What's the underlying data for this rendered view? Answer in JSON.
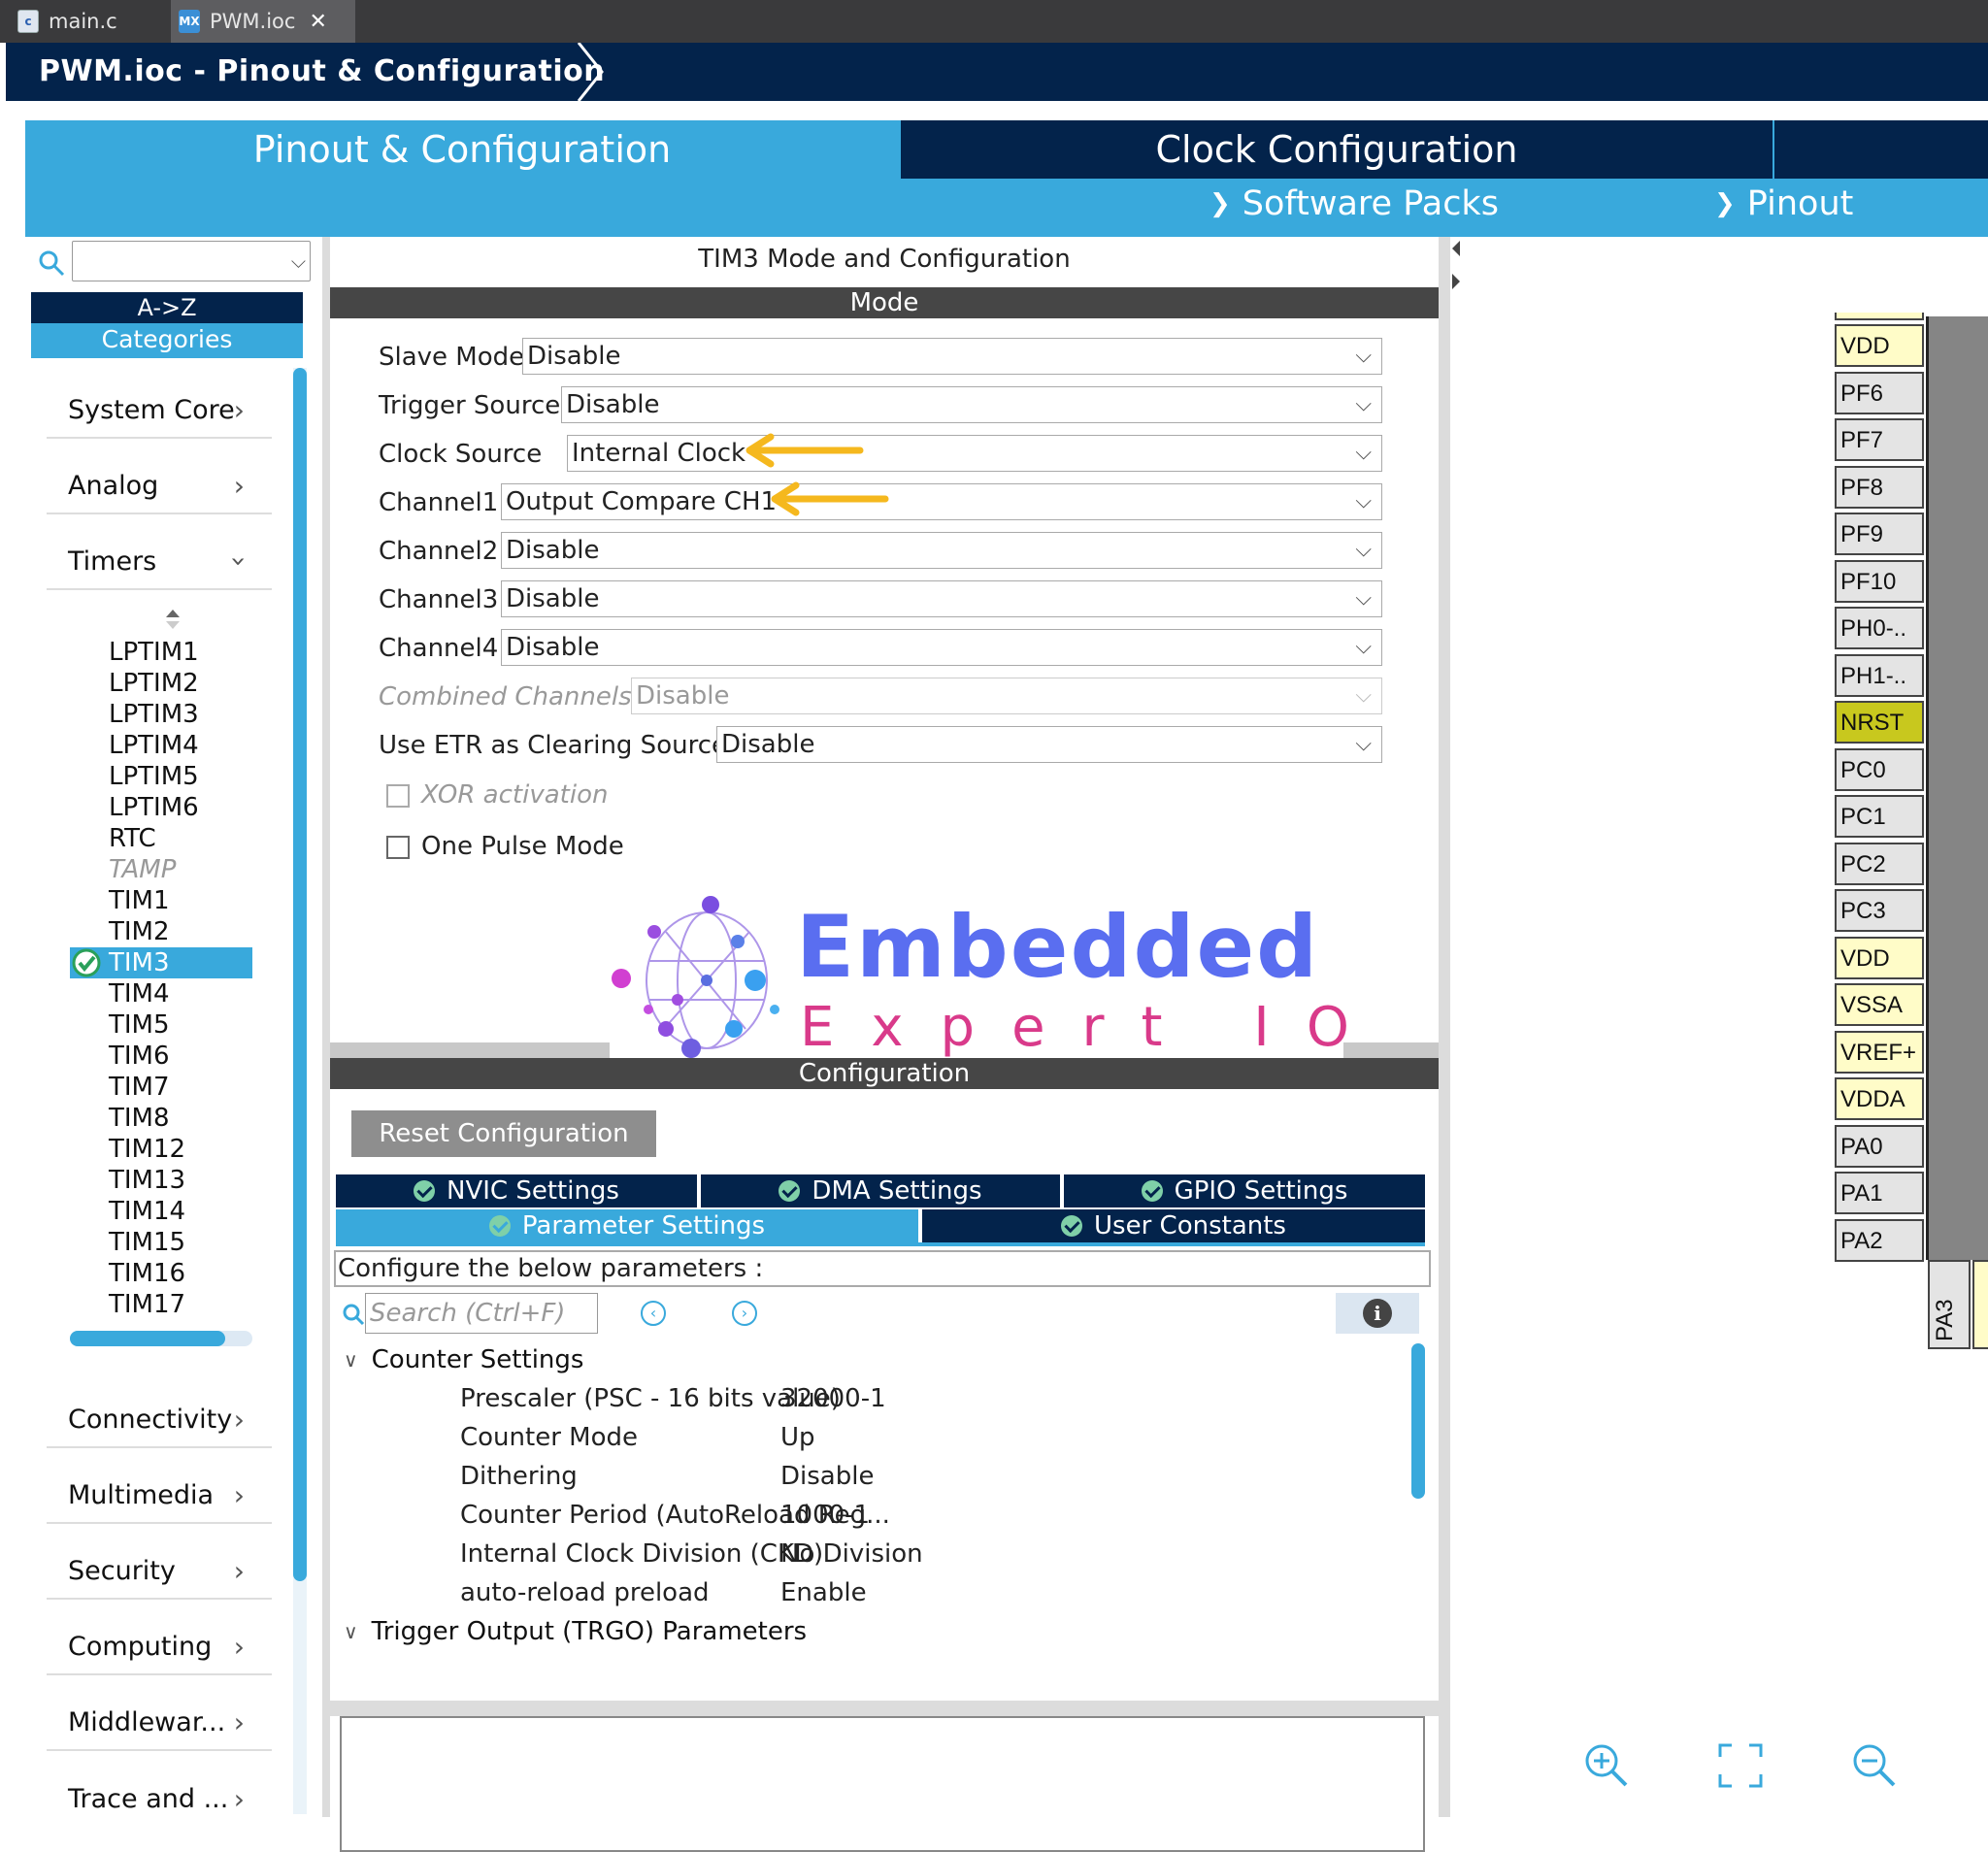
{
  "editor_tabs": [
    {
      "label": "main.c",
      "icon": "c-file-icon",
      "badge": "c"
    },
    {
      "label": "PWM.ioc",
      "icon": "mx-file-icon",
      "badge": "MX"
    }
  ],
  "window_title": "PWM.ioc - Pinout & Configuration",
  "main_tabs": {
    "pinout": "Pinout & Configuration",
    "clock": "Clock Configuration"
  },
  "sub_menus": {
    "software_packs": "Software Packs",
    "pinout": "Pinout"
  },
  "left": {
    "sort": "A->Z",
    "categories": "Categories",
    "cats": {
      "system_core": "System Core",
      "analog": "Analog",
      "timers": "Timers",
      "connectivity": "Connectivity",
      "multimedia": "Multimedia",
      "security": "Security",
      "computing": "Computing",
      "middleware": "Middlewar...",
      "trace": "Trace and ..."
    },
    "timers": [
      "LPTIM1",
      "LPTIM2",
      "LPTIM3",
      "LPTIM4",
      "LPTIM5",
      "LPTIM6",
      "RTC",
      "TAMP",
      "TIM1",
      "TIM2",
      "TIM3",
      "TIM4",
      "TIM5",
      "TIM6",
      "TIM7",
      "TIM8",
      "TIM12",
      "TIM13",
      "TIM14",
      "TIM15",
      "TIM16",
      "TIM17"
    ],
    "selected": "TIM3",
    "disabled": "TAMP"
  },
  "center": {
    "title": "TIM3 Mode and Configuration",
    "mode_bar": "Mode",
    "fields": {
      "slave_mode": {
        "label": "Slave Mode",
        "value": "Disable"
      },
      "trigger_source": {
        "label": "Trigger Source",
        "value": "Disable"
      },
      "clock_source": {
        "label": "Clock Source",
        "value": "Internal Clock"
      },
      "channel1": {
        "label": "Channel1",
        "value": "Output Compare CH1"
      },
      "channel2": {
        "label": "Channel2",
        "value": "Disable"
      },
      "channel3": {
        "label": "Channel3",
        "value": "Disable"
      },
      "channel4": {
        "label": "Channel4",
        "value": "Disable"
      },
      "combined": {
        "label": "Combined Channels",
        "value": "Disable"
      },
      "etr": {
        "label": "Use ETR as Clearing Source",
        "value": "Disable"
      }
    },
    "xor": "XOR activation",
    "one_pulse": "One Pulse Mode",
    "logo": {
      "line1": "Embedded",
      "line2": "Expert IO"
    },
    "config_bar": "Configuration",
    "reset": "Reset Configuration",
    "cfg_tabs": {
      "nvic": "NVIC Settings",
      "dma": "DMA Settings",
      "gpio": "GPIO Settings",
      "param": "Parameter Settings",
      "user": "User Constants"
    },
    "hint": "Configure the below parameters :",
    "search_placeholder": "Search (Ctrl+F)",
    "groups": {
      "counter": "Counter Settings",
      "trgo": "Trigger Output (TRGO) Parameters"
    },
    "params": [
      {
        "name": "Prescaler (PSC - 16 bits value)",
        "value": "32000-1"
      },
      {
        "name": "Counter Mode",
        "value": "Up"
      },
      {
        "name": "Dithering",
        "value": "Disable"
      },
      {
        "name": "Counter Period (AutoReload Reg...",
        "value": "1000-1"
      },
      {
        "name": "Internal Clock Division (CKD)",
        "value": "No Division"
      },
      {
        "name": "auto-reload preload",
        "value": "Enable"
      }
    ]
  },
  "pins": [
    "VDD",
    "PF6",
    "PF7",
    "PF8",
    "PF9",
    "PF10",
    "PH0-..",
    "PH1-..",
    "NRST",
    "PC0",
    "PC1",
    "PC2",
    "PC3",
    "VDD",
    "VSSA",
    "VREF+",
    "VDDA",
    "PA0",
    "PA1",
    "PA2"
  ],
  "pin_bottom": "PA3",
  "colors": {
    "accent": "#39a9dc",
    "navy": "#03234b",
    "arrow": "#f5b81e",
    "nrst": "#c8c81e",
    "supply_pin": "#fffcc8"
  }
}
